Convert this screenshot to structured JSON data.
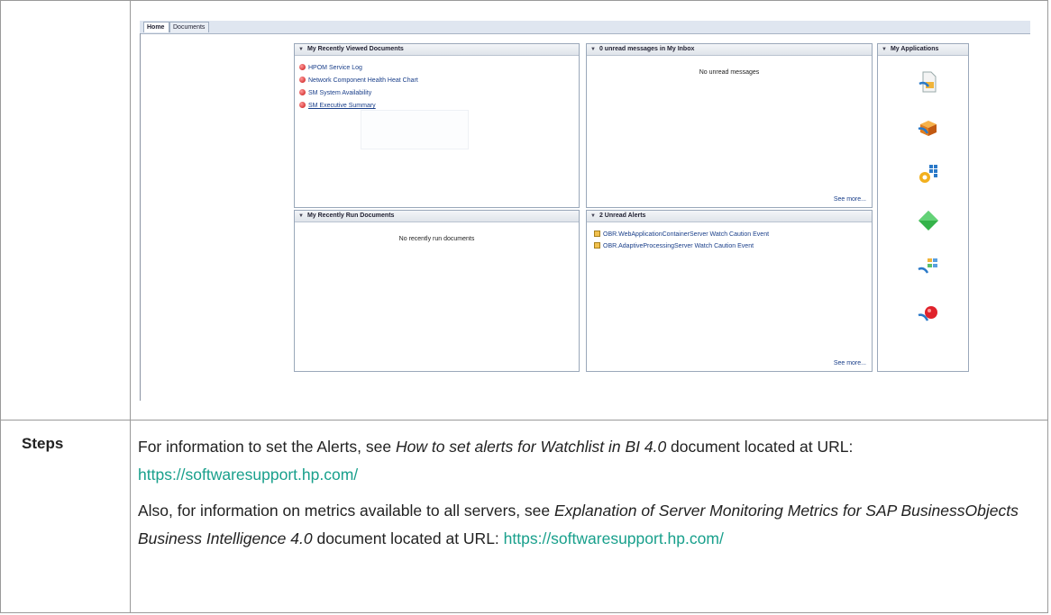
{
  "tabs": [
    "Home",
    "Documents"
  ],
  "panels": {
    "recently_viewed": {
      "title": "My Recently Viewed Documents",
      "items": [
        "HPOM Service Log",
        "Network Component Health Heat Chart",
        "SM System Availability",
        "SM Executive Summary"
      ]
    },
    "inbox": {
      "title": "0 unread messages in My Inbox",
      "empty_text": "No unread messages",
      "see_more": "See more..."
    },
    "recently_run": {
      "title": "My Recently Run Documents",
      "empty_text": "No recently run documents"
    },
    "alerts": {
      "title": "2 Unread Alerts",
      "items": [
        "OBR.WebApplicationContainerServer Watch Caution Event",
        "OBR.AdaptiveProcessingServer Watch Caution Event"
      ],
      "see_more": "See more..."
    },
    "applications": {
      "title": "My Applications",
      "icons": [
        "report-app-icon",
        "cube-app-icon",
        "gear-grid-app-icon",
        "green-diamond-app-icon",
        "flow-app-icon",
        "red-ball-app-icon"
      ]
    }
  },
  "steps": {
    "label": "Steps",
    "p1_a": "For information to set the Alerts, see ",
    "p1_em": "How to set alerts for Watchlist in BI 4.0",
    "p1_b": " document located at URL: ",
    "p1_link": "https://softwaresupport.hp.com/",
    "p2_a": "Also, for information on metrics available to all servers, see ",
    "p2_em": "Explanation of Server Monitoring Metrics for SAP BusinessObjects Business Intelligence 4.0",
    "p2_b": " document located at URL: ",
    "p2_link": "https://softwaresupport.hp.com/"
  },
  "colors": {
    "link": "#19a08c",
    "panel_border": "#9aa8ba"
  }
}
